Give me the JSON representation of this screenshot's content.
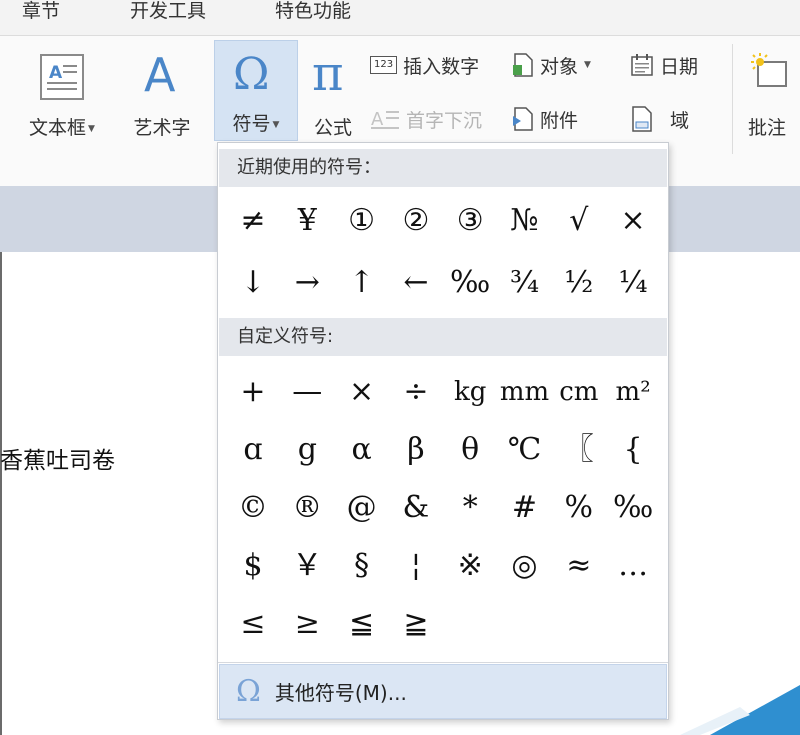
{
  "tabs": [
    "章节",
    "开发工具",
    "特色功能"
  ],
  "ribbon": {
    "textbox_label": "文本框",
    "art_label": "艺术字",
    "symbol_label": "符号",
    "formula_label": "公式",
    "insert_number_label": "插入数字",
    "object_label": "对象",
    "date_label": "日期",
    "dropcap_label": "首字下沉",
    "attachment_label": "附件",
    "field_label": "域",
    "comment_label": "批注",
    "art_glyph": "A",
    "symbol_glyph": "Ω",
    "formula_glyph": "π",
    "num_badge": "123"
  },
  "document": {
    "text": "香蕉吐司卷"
  },
  "dropdown": {
    "recent_header": "近期使用的符号：",
    "recent": [
      "≠",
      "¥",
      "①",
      "②",
      "③",
      "№",
      "√",
      "×",
      "↓",
      "→",
      "↑",
      "←",
      "‰",
      "¾",
      "½",
      "¼"
    ],
    "custom_header": "自定义符号:",
    "custom": [
      "+",
      "—",
      "×",
      "÷",
      "kg",
      "mm",
      "cm",
      "m²",
      "ɑ",
      "g",
      "α",
      "β",
      "θ",
      "℃",
      "〖",
      "{",
      "©",
      "®",
      "@",
      "&",
      "*",
      "#",
      "%",
      "‰",
      "$",
      "￥",
      "§",
      "¦",
      "※",
      "◎",
      "≈",
      "…",
      "≤",
      "≥",
      "≦",
      "≧"
    ],
    "more_label": "其他符号(M)...",
    "more_glyph": "Ω"
  },
  "colors": {
    "accent": "#4a86c8",
    "selected_bg": "#d5e3f3",
    "header_bg": "#e4e7ec",
    "band": "#cfd6e2"
  }
}
